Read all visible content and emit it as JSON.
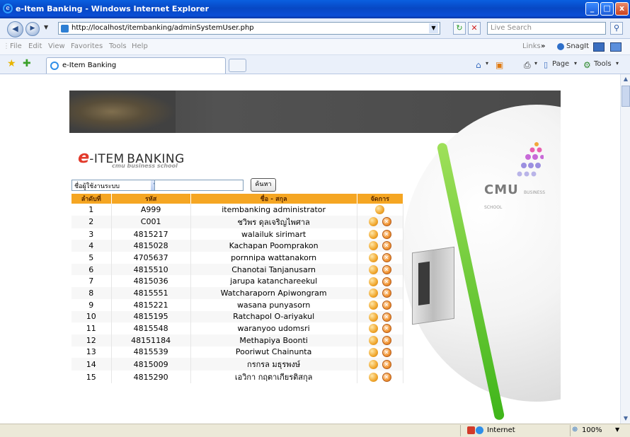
{
  "window": {
    "title": "e-Item Banking - Windows Internet Explorer",
    "controls": [
      "_",
      "□",
      "x"
    ]
  },
  "address_bar": {
    "back": "◀",
    "forward": "▶",
    "url": "http://localhost/itembanking/adminSystemUser.php",
    "live_search_placeholder": "Live Search"
  },
  "menu": {
    "items": [
      "File",
      "Edit",
      "View",
      "Favorites",
      "Tools",
      "Help"
    ],
    "links_label": "Links",
    "snagit_label": "SnagIt"
  },
  "tabs": {
    "active_tab": "e-Item Banking",
    "page_label": "Page",
    "tools_label": "Tools"
  },
  "page": {
    "logo_e": "e",
    "logo_item": "-ITEM",
    "logo_banking": "BANKING",
    "logo_sub": "cmu business school",
    "cmu_logo": "CMU",
    "cmu_logo_small": "BUSINESS SCHOOL",
    "filter_value": "ชื่อผู้ใช้งานระบบ",
    "search_button": "ค้นหา",
    "table": {
      "headers": [
        "ลำดับที่",
        "รหัส",
        "ชื่อ - สกุล",
        "จัดการ"
      ],
      "rows": [
        {
          "no": "1",
          "code": "A999",
          "name": "itembanking administrator",
          "deletable": false
        },
        {
          "no": "2",
          "code": "C001",
          "name": "ชวิพร ดุลเจริญไพศาล",
          "deletable": true
        },
        {
          "no": "3",
          "code": "4815217",
          "name": "walailuk sirimart",
          "deletable": true
        },
        {
          "no": "4",
          "code": "4815028",
          "name": "Kachapan Poomprakon",
          "deletable": true
        },
        {
          "no": "5",
          "code": "4705637",
          "name": "pornnipa wattanakorn",
          "deletable": true
        },
        {
          "no": "6",
          "code": "4815510",
          "name": "Chanotai Tanjanusarn",
          "deletable": true
        },
        {
          "no": "7",
          "code": "4815036",
          "name": "jarupa katanchareekul",
          "deletable": true
        },
        {
          "no": "8",
          "code": "4815551",
          "name": "Watcharaporn Apiwongram",
          "deletable": true
        },
        {
          "no": "9",
          "code": "4815221",
          "name": "wasana punyasorn",
          "deletable": true
        },
        {
          "no": "10",
          "code": "4815195",
          "name": "Ratchapol O-ariyakul",
          "deletable": true
        },
        {
          "no": "11",
          "code": "4815548",
          "name": "waranyoo udomsri",
          "deletable": true
        },
        {
          "no": "12",
          "code": "48151184",
          "name": "Methapiya Boonti",
          "deletable": true
        },
        {
          "no": "13",
          "code": "4815539",
          "name": "Pooriwut Chainunta",
          "deletable": true
        },
        {
          "no": "14",
          "code": "4815009",
          "name": "กรกรล มธุรพงษ์",
          "deletable": true
        },
        {
          "no": "15",
          "code": "4815290",
          "name": "เอวิกา กฤตาเกียรติสกุล",
          "deletable": true
        }
      ]
    }
  },
  "status": {
    "zone": "Internet",
    "zoom": "100%"
  },
  "colors": {
    "table_header": "#f5a623",
    "titlebar": "#0747c4",
    "accent_green": "#3fb51a"
  }
}
